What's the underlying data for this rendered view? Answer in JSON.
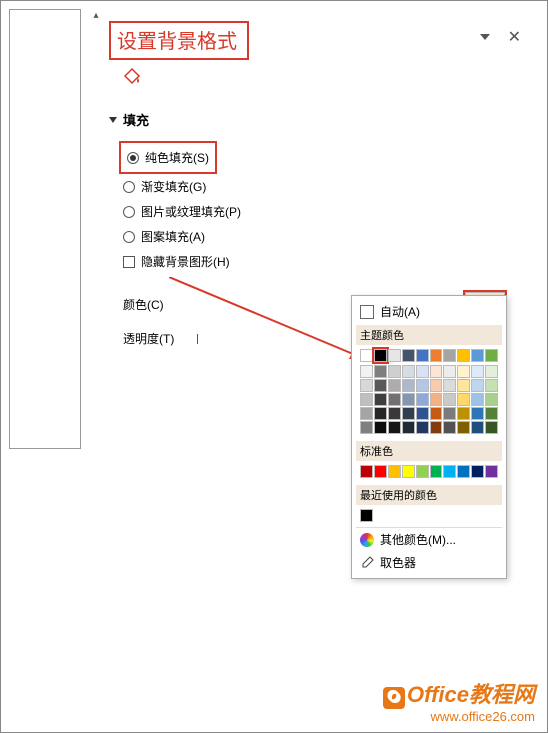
{
  "panel": {
    "title": "设置背景格式",
    "section_title": "填充",
    "options": {
      "solid": "纯色填充(S)",
      "gradient": "渐变填充(G)",
      "picture": "图片或纹理填充(P)",
      "pattern": "图案填充(A)",
      "hide_bg": "隐藏背景图形(H)"
    },
    "color_label": "颜色(C)",
    "transparency_label": "透明度(T)"
  },
  "color_popup": {
    "auto": "自动(A)",
    "theme_label": "主题颜色",
    "standard_label": "标准色",
    "recent_label": "最近使用的颜色",
    "more_colors": "其他颜色(M)...",
    "eyedropper": "取色器",
    "theme_row1": [
      "#ffffff",
      "#000000",
      "#e7e6e6",
      "#44546a",
      "#4472c4",
      "#ed7d31",
      "#a5a5a5",
      "#ffc000",
      "#5b9bd5",
      "#70ad47"
    ],
    "theme_shades": [
      [
        "#f2f2f2",
        "#7f7f7f",
        "#d0cece",
        "#d6dce4",
        "#d9e2f3",
        "#fbe5d5",
        "#ededed",
        "#fff2cc",
        "#deebf6",
        "#e2efd9"
      ],
      [
        "#d8d8d8",
        "#595959",
        "#aeabab",
        "#adb9ca",
        "#b4c6e7",
        "#f7cbac",
        "#dbdbdb",
        "#fee599",
        "#bdd7ee",
        "#c5e0b3"
      ],
      [
        "#bfbfbf",
        "#3f3f3f",
        "#757070",
        "#8496b0",
        "#8eaadb",
        "#f4b183",
        "#c9c9c9",
        "#ffd965",
        "#9cc3e5",
        "#a8d08d"
      ],
      [
        "#a5a5a5",
        "#262626",
        "#3a3838",
        "#323f4f",
        "#2f5496",
        "#c55a11",
        "#7b7b7b",
        "#bf9000",
        "#2e75b5",
        "#538135"
      ],
      [
        "#7f7f7f",
        "#0c0c0c",
        "#171616",
        "#222a35",
        "#1f3864",
        "#833c0b",
        "#525252",
        "#7f6000",
        "#1e4e79",
        "#375623"
      ]
    ],
    "standard": [
      "#c00000",
      "#ff0000",
      "#ffc000",
      "#ffff00",
      "#92d050",
      "#00b050",
      "#00b0f0",
      "#0070c0",
      "#002060",
      "#7030a0"
    ],
    "recent": [
      "#000000"
    ]
  },
  "watermark": {
    "name": "Office教程网",
    "url": "www.office26.com"
  }
}
